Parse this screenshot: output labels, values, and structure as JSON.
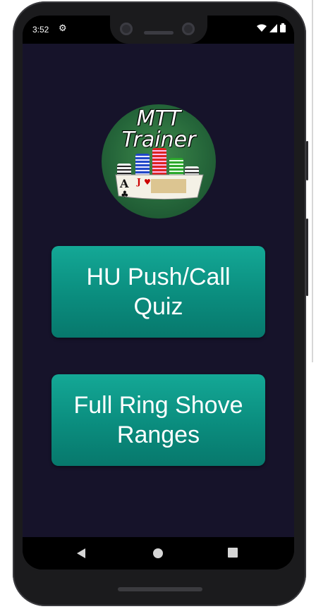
{
  "status_bar": {
    "time": "3:52"
  },
  "logo": {
    "line1": "MTT",
    "line2": "Trainer"
  },
  "menu": {
    "hu_quiz_label": "HU Push/Call Quiz",
    "full_ring_label": "Full Ring Shove Ranges"
  },
  "colors": {
    "background": "#16132a",
    "button": "#0b8f80"
  },
  "icons": [
    "gear-icon",
    "wifi-icon",
    "signal-icon",
    "battery-icon",
    "back-icon",
    "home-icon",
    "recents-icon"
  ]
}
